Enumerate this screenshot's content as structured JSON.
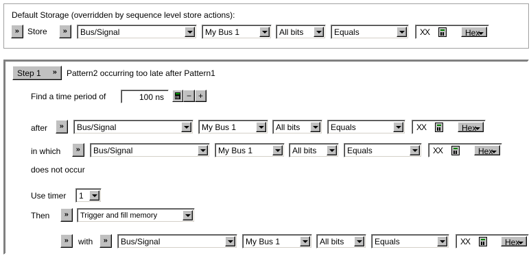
{
  "default_storage": {
    "heading": "Default Storage (overridden by sequence level store actions):",
    "store_label": "Store",
    "source": "Bus/Signal",
    "bus": "My Bus 1",
    "bits": "All bits",
    "operator": "Equals",
    "value": "XX",
    "radix": "Hex"
  },
  "step": {
    "button_label": "Step 1",
    "description": "Pattern2 occurring too late after Pattern1",
    "find_label": "Find a time period of",
    "time_value": "100 ns",
    "minus_label": "−",
    "plus_label": "+",
    "after": {
      "label": "after",
      "source": "Bus/Signal",
      "bus": "My Bus 1",
      "bits": "All bits",
      "operator": "Equals",
      "value": "XX",
      "radix": "Hex"
    },
    "in_which": {
      "label": "in which",
      "source": "Bus/Signal",
      "bus": "My Bus 1",
      "bits": "All bits",
      "operator": "Equals",
      "value": "XX",
      "radix": "Hex"
    },
    "does_not_occur": "does not occur",
    "timer_label": "Use timer",
    "timer_value": "1",
    "then_label": "Then",
    "action": "Trigger and fill memory",
    "with": {
      "label": "with",
      "source": "Bus/Signal",
      "bus": "My Bus 1",
      "bits": "All bits",
      "operator": "Equals",
      "value": "XX",
      "radix": "Hex"
    }
  }
}
